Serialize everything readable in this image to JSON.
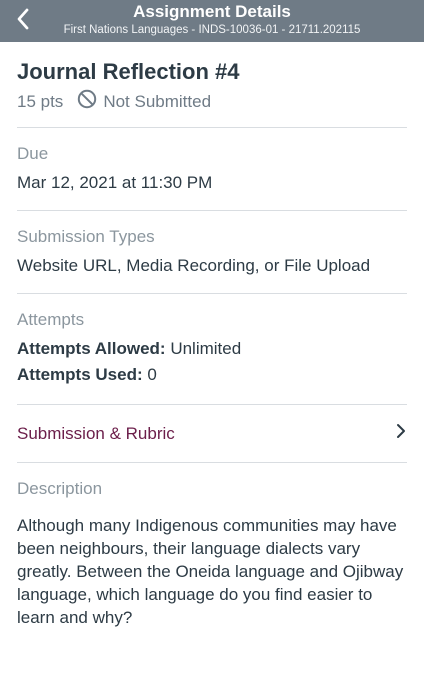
{
  "nav": {
    "title": "Assignment Details",
    "subtitle": "First Nations Languages - INDS-10036-01 - 21711.202115",
    "back_icon": "chevron-left-icon"
  },
  "assignment": {
    "title": "Journal Reflection #4",
    "points": "15 pts",
    "status": "Not Submitted",
    "status_icon": "no-entry-icon"
  },
  "due": {
    "label": "Due",
    "value": "Mar 12, 2021 at 11:30 PM"
  },
  "submission_types": {
    "label": "Submission Types",
    "value": "Website URL, Media Recording, or File Upload"
  },
  "attempts": {
    "label": "Attempts",
    "allowed_label": "Attempts Allowed:",
    "allowed_value": "Unlimited",
    "used_label": "Attempts Used:",
    "used_value": "0"
  },
  "rubric": {
    "label": "Submission & Rubric",
    "icon": "chevron-right-icon"
  },
  "description": {
    "label": "Description",
    "text": "Although many Indigenous communities may have been neighbours, their language dialects vary greatly. Between the Oneida language and Ojibway language, which language do you find easier to learn and why?"
  },
  "colors": {
    "navbar": "#6f7b86",
    "text": "#2d3b45",
    "muted": "#8b969e",
    "accent": "#6b1e4a",
    "divider": "#d9dde1"
  }
}
